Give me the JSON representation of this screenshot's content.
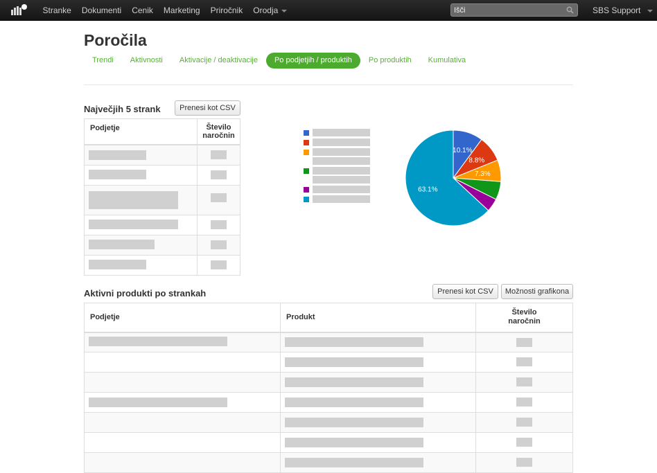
{
  "topbar": {
    "nav": [
      "Stranke",
      "Dokumenti",
      "Cenik",
      "Marketing",
      "Priročnik",
      "Orodja"
    ],
    "search_placeholder": "Išči",
    "user_menu": "SBS Support"
  },
  "page": {
    "title": "Poročila",
    "tabs": [
      {
        "label": "Trendi",
        "active": false
      },
      {
        "label": "Aktivnosti",
        "active": false
      },
      {
        "label": "Aktivacije / deaktivacije",
        "active": false
      },
      {
        "label": "Po podjetjih / produktih",
        "active": true
      },
      {
        "label": "Po produktih",
        "active": false
      },
      {
        "label": "Kumulativa",
        "active": false
      }
    ]
  },
  "top5": {
    "title": "Največjih 5 strank",
    "csv_button": "Prenesi kot CSV",
    "columns": [
      "Podjetje",
      "Število naročnin"
    ]
  },
  "pie": {
    "colors": [
      "#3366cc",
      "#dc3912",
      "#ff9900",
      "#109618",
      "#990099",
      "#0099c6"
    ],
    "labels": [
      "10.1%",
      "8.8%",
      "7.3%",
      "",
      "",
      "63.1%"
    ]
  },
  "chart_data": {
    "type": "pie",
    "values": [
      10.1,
      8.8,
      7.3,
      6.2,
      4.5,
      63.1
    ],
    "colors": [
      "#3366cc",
      "#dc3912",
      "#ff9900",
      "#109618",
      "#990099",
      "#0099c6"
    ]
  },
  "active_products": {
    "title": "Aktivni produkti po strankah",
    "csv_button": "Prenesi kot CSV",
    "chart_options_button": "Možnosti grafikona",
    "columns": [
      "Podjetje",
      "Produkt",
      "Število naročnin"
    ]
  }
}
